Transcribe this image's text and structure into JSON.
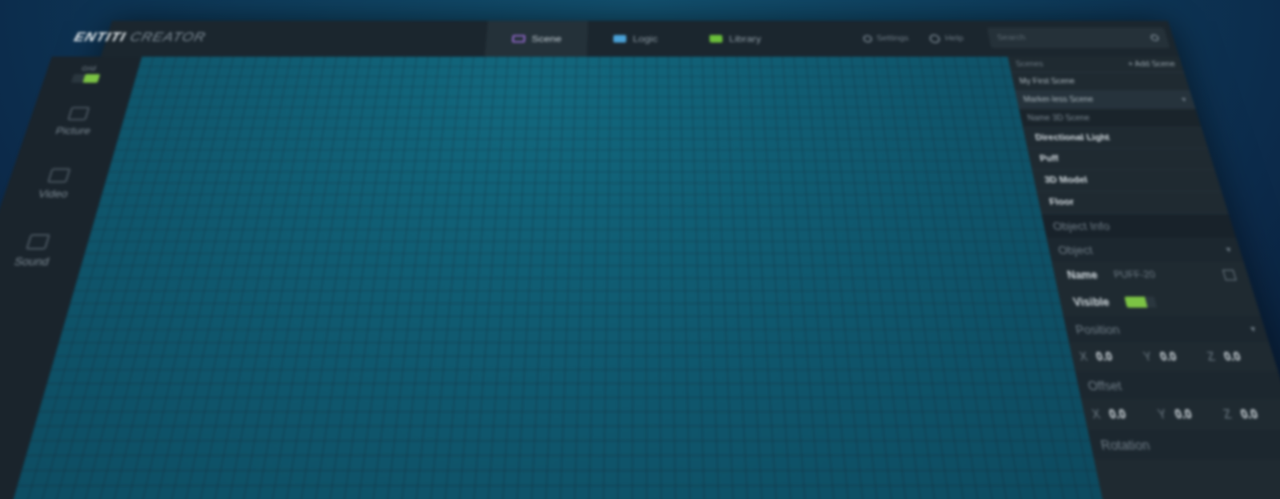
{
  "brand": {
    "part1": "ENTITI",
    "part2": "CREATOR"
  },
  "tabs": [
    {
      "label": "Scene",
      "icon": "scene-icon"
    },
    {
      "label": "Logic",
      "icon": "logic-icon"
    },
    {
      "label": "Library",
      "icon": "library-icon"
    }
  ],
  "toolbar": {
    "settings": "Settings",
    "help": "Help",
    "search_placeholder": "Search"
  },
  "left": {
    "switch_label": "Grid",
    "items": [
      {
        "label": "Picture"
      },
      {
        "label": "Video"
      },
      {
        "label": "Sound"
      }
    ]
  },
  "right": {
    "scenes_header": "Scenes",
    "add_scene": "+ Add Scene",
    "scenes": [
      "My First Scene",
      "Marker-less Scene",
      "Name 3D Scene"
    ],
    "objects": [
      "Directional Light",
      "Puff",
      "3D Model",
      "Floor"
    ],
    "object_info": "Object Info",
    "object_section": "Object",
    "name_label": "Name",
    "name_value": "PUFF-20",
    "visible_label": "Visible",
    "position_label": "Position",
    "position": {
      "x": "0.0",
      "y": "0.0",
      "z": "0.0"
    },
    "offset_label": "Offset",
    "offset": {
      "x": "0.0",
      "y": "0.0",
      "z": "0.0"
    },
    "rotation_label": "Rotation"
  },
  "colors": {
    "accent_tab": "#b05fd0",
    "toggle_on": "#7cc444",
    "viewport": "#0f5a70"
  }
}
